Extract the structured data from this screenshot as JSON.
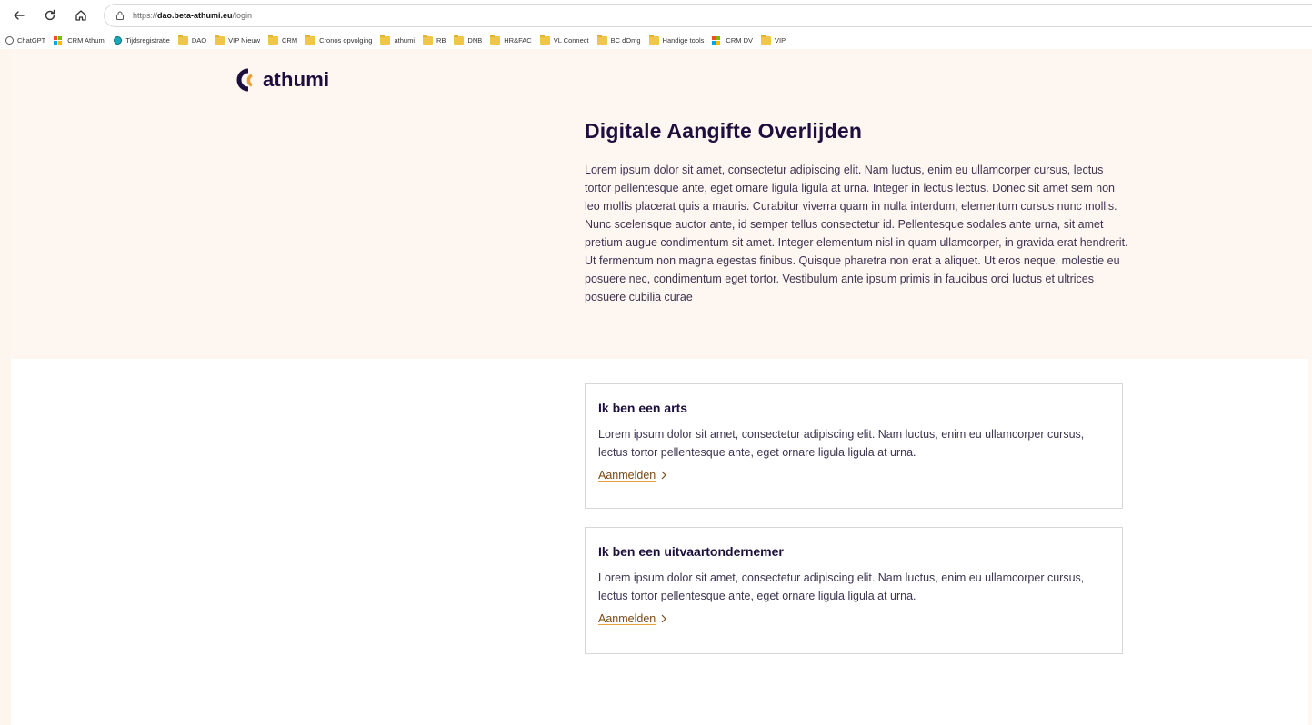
{
  "browser": {
    "url_prefix": "https://",
    "url_host": "dao.beta-athumi.eu",
    "url_path": "/login",
    "bookmarks": [
      {
        "label": "ChatGPT",
        "icon": "chatgpt-icon"
      },
      {
        "label": "CRM Athumi",
        "icon": "microsoft-icon"
      },
      {
        "label": "Tijdsregistratie",
        "icon": "globe-icon"
      },
      {
        "label": "DAO",
        "icon": "folder-icon"
      },
      {
        "label": "VIP Nieuw",
        "icon": "folder-icon"
      },
      {
        "label": "CRM",
        "icon": "folder-icon"
      },
      {
        "label": "Cronos opvolging",
        "icon": "folder-icon"
      },
      {
        "label": "athumi",
        "icon": "folder-icon"
      },
      {
        "label": "RB",
        "icon": "folder-icon"
      },
      {
        "label": "DNB",
        "icon": "folder-icon"
      },
      {
        "label": "HR&FAC",
        "icon": "folder-icon"
      },
      {
        "label": "VL Connect",
        "icon": "folder-icon"
      },
      {
        "label": "BC dOmg",
        "icon": "folder-icon"
      },
      {
        "label": "Handige tools",
        "icon": "folder-icon"
      },
      {
        "label": "CRM DV",
        "icon": "microsoft-icon"
      },
      {
        "label": "VIP",
        "icon": "folder-icon"
      }
    ]
  },
  "logo": {
    "text": "athumi"
  },
  "hero": {
    "title": "Digitale Aangifte Overlijden",
    "intro": "Lorem ipsum dolor sit amet, consectetur adipiscing elit. Nam luctus, enim eu ullamcorper cursus, lectus tortor pellentesque ante, eget ornare ligula ligula at urna. Integer in lectus lectus. Donec sit amet sem non leo mollis placerat quis a mauris. Curabitur viverra quam in nulla interdum, elementum cursus nunc mollis. Nunc scelerisque auctor ante, id semper tellus consectetur id. Pellentesque sodales ante urna, sit amet pretium augue condimentum sit amet. Integer elementum nisl in quam ullamcorper, in gravida erat hendrerit. Ut fermentum non magna egestas finibus. Quisque pharetra non erat a aliquet. Ut eros neque, molestie eu posuere nec, condimentum eget tortor. Vestibulum ante ipsum primis in faucibus orci luctus et ultrices posuere cubilia curae"
  },
  "cards": [
    {
      "title": "Ik ben een arts",
      "text": "Lorem ipsum dolor sit amet, consectetur adipiscing elit. Nam luctus, enim eu ullamcorper cursus, lectus tortor pellentesque ante, eget ornare ligula ligula at urna.",
      "link": "Aanmelden"
    },
    {
      "title": "Ik ben een uitvaartondernemer",
      "text": "Lorem ipsum dolor sit amet, consectetur adipiscing elit. Nam luctus, enim eu ullamcorper cursus, lectus tortor pellentesque ante, eget ornare ligula ligula at urna.",
      "link": "Aanmelden"
    }
  ],
  "colors": {
    "brand_dark": "#1c0f3d",
    "brand_accent": "#e9a13b",
    "hero_bg": "#fef6f0"
  }
}
